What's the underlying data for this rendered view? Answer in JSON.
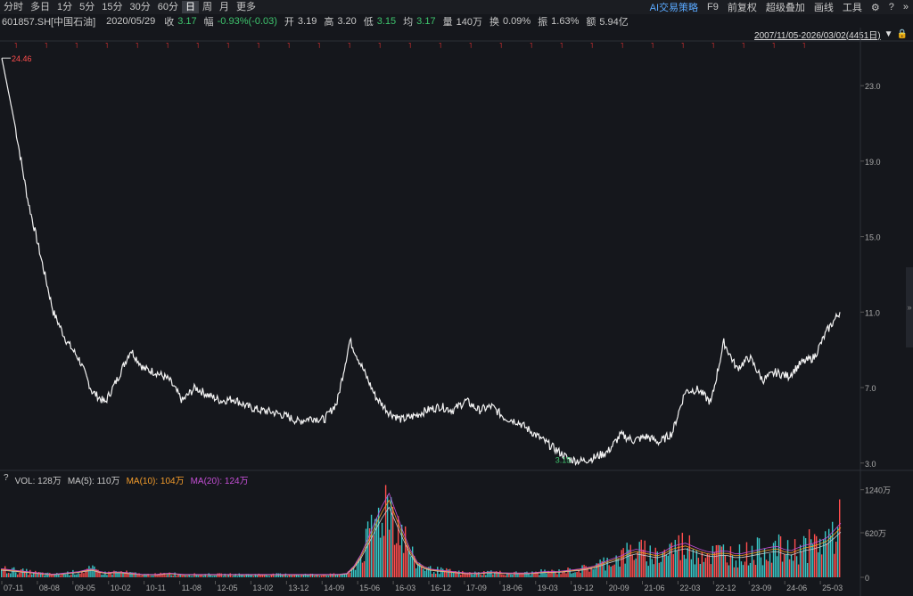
{
  "periods": [
    "分时",
    "多日",
    "1分",
    "5分",
    "15分",
    "30分",
    "60分",
    "日",
    "周",
    "月",
    "更多"
  ],
  "active_period": "日",
  "tools": {
    "ai": "AI交易策略",
    "f9": "F9",
    "fq": "前复权",
    "overlay": "超级叠加",
    "draw": "画线",
    "tools": "工具"
  },
  "info": {
    "code": "601857.SH[中国石油]",
    "date": "2020/05/29",
    "close_label": "收",
    "close": "3.17",
    "change_label": "幅",
    "change": "-0.93%(-0.03)",
    "open_label": "开",
    "open": "3.19",
    "high_label": "高",
    "high": "3.20",
    "low_label": "低",
    "low": "3.15",
    "avg_label": "均",
    "avg": "3.17",
    "vol_label": "量",
    "vol": "140万",
    "turn_label": "换",
    "turn": "0.09%",
    "amp_label": "振",
    "amp": "1.63%",
    "amt_label": "额",
    "amt": "5.94亿"
  },
  "range": "2007/11/05-2026/03/02(4451日)",
  "vol_panel": {
    "help": "?",
    "vol": "VOL: 128万",
    "ma5": "MA(5): 110万",
    "ma10": "MA(10): 104万",
    "ma20": "MA(20): 124万",
    "colors": {
      "ma5": "#c8c8c8",
      "ma10": "#f39c2b",
      "ma20": "#c54fd6",
      "bar": "#38c6c6"
    }
  },
  "chart_data": {
    "type": "line",
    "x_ticks": [
      "07-11",
      "08-08",
      "09-05",
      "10-02",
      "10-11",
      "11-08",
      "12-05",
      "13-02",
      "13-12",
      "14-09",
      "15-06",
      "16-03",
      "16-12",
      "17-09",
      "18-06",
      "19-03",
      "19-12",
      "20-09",
      "21-06",
      "22-03",
      "22-12",
      "23-09",
      "24-06",
      "25-03"
    ],
    "y_ticks": [
      3.0,
      7.0,
      11.0,
      15.0,
      19.0,
      23.0
    ],
    "ylim": [
      2.8,
      24.8
    ],
    "max_label": "24.46",
    "min_label": "3.15",
    "series": [
      {
        "points": [
          [
            0,
            24.46
          ],
          [
            1,
            21
          ],
          [
            2,
            17
          ],
          [
            3,
            14
          ],
          [
            4,
            11
          ],
          [
            5,
            9.5
          ],
          [
            6,
            8.5
          ],
          [
            7,
            6.8
          ],
          [
            8,
            6.2
          ],
          [
            9,
            7.5
          ],
          [
            10,
            9.0
          ],
          [
            11,
            8.0
          ],
          [
            12,
            7.8
          ],
          [
            13,
            7.4
          ],
          [
            14,
            6.3
          ],
          [
            15,
            7.0
          ],
          [
            16,
            6.6
          ],
          [
            17,
            6.3
          ],
          [
            18,
            6.4
          ],
          [
            19,
            6.0
          ],
          [
            20,
            5.8
          ],
          [
            21,
            5.7
          ],
          [
            22,
            5.5
          ],
          [
            23,
            5.2
          ],
          [
            24,
            5.4
          ],
          [
            25,
            5.3
          ],
          [
            26,
            6.2
          ],
          [
            27,
            9.5
          ],
          [
            28,
            8.0
          ],
          [
            29,
            6.5
          ],
          [
            30,
            5.7
          ],
          [
            31,
            5.3
          ],
          [
            32,
            5.5
          ],
          [
            33,
            5.8
          ],
          [
            34,
            6.0
          ],
          [
            35,
            5.8
          ],
          [
            36,
            6.3
          ],
          [
            37,
            5.8
          ],
          [
            38,
            6.0
          ],
          [
            39,
            5.4
          ],
          [
            40,
            5.2
          ],
          [
            41,
            4.7
          ],
          [
            42,
            4.2
          ],
          [
            43,
            3.7
          ],
          [
            44,
            3.2
          ],
          [
            45,
            3.1
          ],
          [
            46,
            3.3
          ],
          [
            47,
            3.6
          ],
          [
            48,
            4.5
          ],
          [
            49,
            4.2
          ],
          [
            50,
            4.4
          ],
          [
            51,
            4.1
          ],
          [
            52,
            4.6
          ],
          [
            53,
            6.8
          ],
          [
            54,
            6.9
          ],
          [
            55,
            6.2
          ],
          [
            56,
            9.4
          ],
          [
            57,
            8.0
          ],
          [
            58,
            8.6
          ],
          [
            59,
            7.4
          ],
          [
            60,
            7.8
          ],
          [
            61,
            7.6
          ],
          [
            62,
            8.3
          ],
          [
            63,
            8.6
          ],
          [
            64,
            10.0
          ],
          [
            65,
            11.0
          ]
        ]
      }
    ],
    "volume": [
      6,
      5,
      4,
      3,
      2,
      3,
      4,
      6,
      3,
      4,
      3,
      2,
      2,
      3,
      2,
      2,
      2,
      2,
      2,
      2,
      2,
      2,
      2,
      2,
      2,
      2,
      2,
      3,
      18,
      40,
      60,
      35,
      12,
      6,
      5,
      4,
      3,
      3,
      4,
      3,
      3,
      3,
      4,
      4,
      5,
      6,
      8,
      12,
      15,
      20,
      18,
      16,
      22,
      24,
      20,
      17,
      19,
      16,
      18,
      20,
      22,
      18,
      22,
      24,
      28,
      38
    ],
    "vol_ticks": [
      "1240万",
      "620万",
      "0"
    ]
  }
}
